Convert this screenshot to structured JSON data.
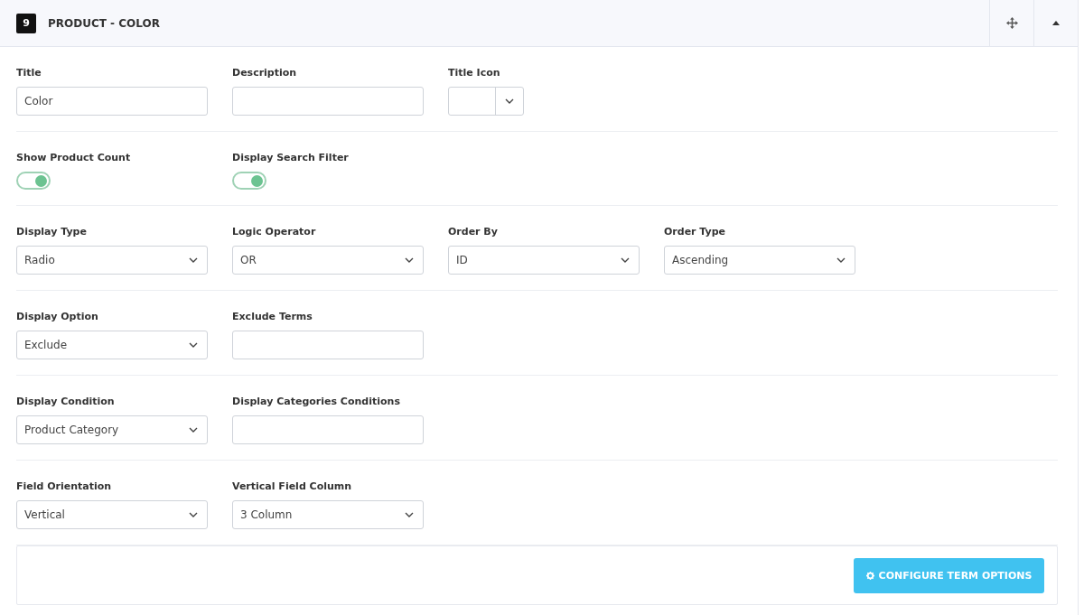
{
  "header": {
    "number": "9",
    "title": "PRODUCT - COLOR"
  },
  "rows": [
    {
      "fields": [
        {
          "kind": "text",
          "label": "Title",
          "value": "Color"
        },
        {
          "kind": "text",
          "label": "Description"
        },
        {
          "kind": "icon-select",
          "label": "Title Icon"
        }
      ]
    },
    {
      "fields": [
        {
          "kind": "toggle",
          "label": "Show Product Count",
          "on": true
        },
        {
          "kind": "toggle",
          "label": "Display Search Filter",
          "on": true
        }
      ]
    },
    {
      "fields": [
        {
          "kind": "select",
          "label": "Display Type",
          "value": "Radio"
        },
        {
          "kind": "select",
          "label": "Logic Operator",
          "value": "OR"
        },
        {
          "kind": "select",
          "label": "Order By",
          "value": "ID"
        },
        {
          "kind": "select",
          "label": "Order Type",
          "value": "Ascending"
        }
      ]
    },
    {
      "fields": [
        {
          "kind": "select",
          "label": "Display Option",
          "value": "Exclude"
        },
        {
          "kind": "text",
          "label": "Exclude Terms"
        }
      ]
    },
    {
      "fields": [
        {
          "kind": "select",
          "label": "Display Condition",
          "value": "Product Category"
        },
        {
          "kind": "text",
          "label": "Display Categories Conditions"
        }
      ]
    },
    {
      "fields": [
        {
          "kind": "select",
          "label": "Field Orientation",
          "value": "Vertical"
        },
        {
          "kind": "select",
          "label": "Vertical Field Column",
          "value": "3 Column"
        }
      ]
    }
  ],
  "footer": {
    "button": "CONFIGURE TERM OPTIONS"
  }
}
